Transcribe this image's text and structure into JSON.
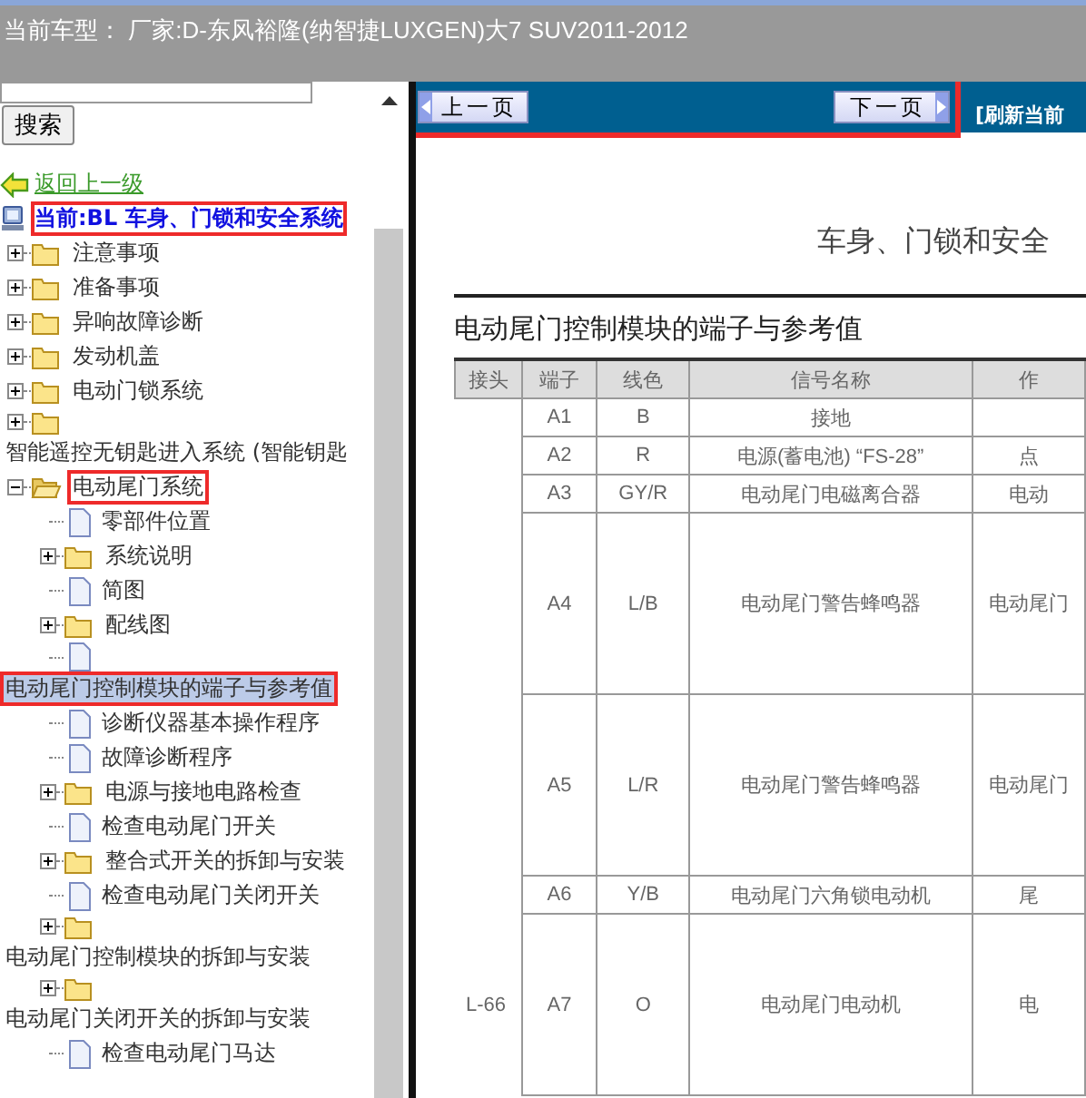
{
  "header": {
    "label": "当前车型：",
    "value": "厂家:D-东风裕隆(纳智捷LUXGEN)大7 SUV2011-2012"
  },
  "search": {
    "button": "搜索"
  },
  "tree": {
    "back_link": "返回上一级",
    "current": {
      "text": "当前:BL 车身、门锁和安全系统",
      "highlighted": true
    },
    "items": [
      {
        "kind": "folder",
        "label": "注意事项",
        "expanded": false,
        "selected": false,
        "highlighted": false
      },
      {
        "kind": "folder",
        "label": "准备事项",
        "expanded": false,
        "selected": false,
        "highlighted": false
      },
      {
        "kind": "folder",
        "label": "异响故障诊断",
        "expanded": false,
        "selected": false,
        "highlighted": false
      },
      {
        "kind": "folder",
        "label": "发动机盖",
        "expanded": false,
        "selected": false,
        "highlighted": false
      },
      {
        "kind": "folder",
        "label": "电动门锁系统",
        "expanded": false,
        "selected": false,
        "highlighted": false
      },
      {
        "kind": "folder",
        "label": "智能遥控无钥匙进入系统 (智能钥匙",
        "expanded": false,
        "selected": false,
        "highlighted": false
      },
      {
        "kind": "folder",
        "label": "电动尾门系统",
        "expanded": true,
        "selected": false,
        "highlighted": true,
        "children": [
          {
            "kind": "document",
            "label": "零部件位置",
            "selected": false,
            "highlighted": false
          },
          {
            "kind": "folder",
            "label": "系统说明",
            "expanded": false,
            "selected": false,
            "highlighted": false
          },
          {
            "kind": "document",
            "label": "简图",
            "selected": false,
            "highlighted": false
          },
          {
            "kind": "folder",
            "label": "配线图",
            "expanded": false,
            "selected": false,
            "highlighted": false
          },
          {
            "kind": "document",
            "label": "电动尾门控制模块的端子与参考值",
            "selected": true,
            "highlighted": true
          },
          {
            "kind": "document",
            "label": "诊断仪器基本操作程序",
            "selected": false,
            "highlighted": false
          },
          {
            "kind": "document",
            "label": "故障诊断程序",
            "selected": false,
            "highlighted": false
          },
          {
            "kind": "folder",
            "label": "电源与接地电路检查",
            "expanded": false,
            "selected": false,
            "highlighted": false
          },
          {
            "kind": "document",
            "label": "检查电动尾门开关",
            "selected": false,
            "highlighted": false
          },
          {
            "kind": "folder",
            "label": "整合式开关的拆卸与安装",
            "expanded": false,
            "selected": false,
            "highlighted": false
          },
          {
            "kind": "document",
            "label": "检查电动尾门关闭开关",
            "selected": false,
            "highlighted": false
          },
          {
            "kind": "folder",
            "label": "电动尾门控制模块的拆卸与安装",
            "expanded": false,
            "selected": false,
            "highlighted": false
          },
          {
            "kind": "folder",
            "label": "电动尾门关闭开关的拆卸与安装",
            "expanded": false,
            "selected": false,
            "highlighted": false
          },
          {
            "kind": "document",
            "label": "检查电动尾门马达",
            "selected": false,
            "highlighted": false
          }
        ]
      }
    ]
  },
  "nav": {
    "prev": "上一页",
    "next": "下一页",
    "refresh": "[刷新当前",
    "highlighted": true
  },
  "document": {
    "section_title": "车身、门锁和安全",
    "heading": "电动尾门控制模块的端子与参考值",
    "table": {
      "columns": [
        "接头",
        "端子",
        "线色",
        "信号名称",
        "作"
      ],
      "rows": [
        {
          "kind": "short",
          "cells": [
            "",
            "A1",
            "B",
            "接地",
            ""
          ]
        },
        {
          "kind": "short",
          "cells": [
            "",
            "A2",
            "R",
            "电源(蓄电池) “FS-28”",
            "点"
          ]
        },
        {
          "kind": "short",
          "cells": [
            "",
            "A3",
            "GY/R",
            "电动尾门电磁离合器",
            "电动"
          ]
        },
        {
          "kind": "tall",
          "cells": [
            "",
            "A4",
            "L/B",
            "电动尾门警告蜂鸣器",
            "电动尾门"
          ]
        },
        {
          "kind": "tall",
          "cells": [
            "",
            "A5",
            "L/R",
            "电动尾门警告蜂鸣器",
            "电动尾门"
          ]
        },
        {
          "kind": "short",
          "cells": [
            "",
            "A6",
            "Y/B",
            "电动尾门六角锁电动机",
            "尾"
          ]
        },
        {
          "kind": "tall",
          "cells": [
            "L-66",
            "A7",
            "O",
            "电动尾门电动机",
            "电"
          ]
        }
      ]
    }
  }
}
